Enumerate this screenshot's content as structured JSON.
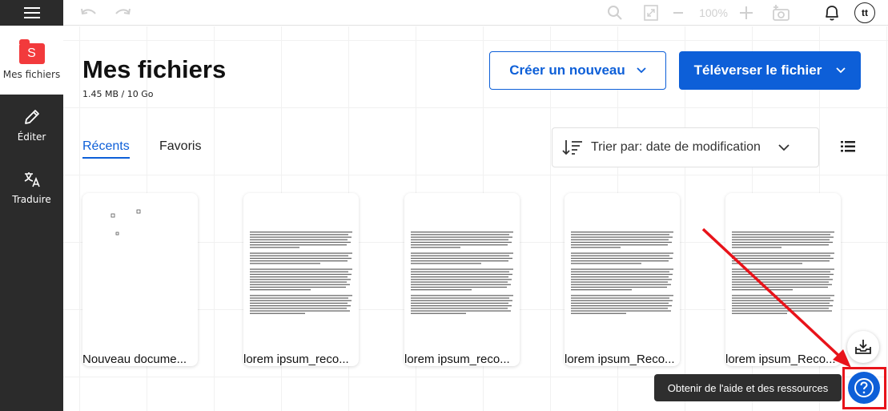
{
  "sidebar": {
    "items": [
      {
        "label": "Mes fichiers",
        "icon": "folder-icon"
      },
      {
        "label": "Éditer",
        "icon": "pencil-icon"
      },
      {
        "label": "Traduire",
        "icon": "translate-icon"
      }
    ],
    "logo_letter": "S"
  },
  "toolbar": {
    "zoom": "100%",
    "avatar_initials": "tt"
  },
  "main": {
    "title": "Mes fichiers",
    "storage": "1.45 MB / 10 Go",
    "create_button": "Créer un nouveau",
    "upload_button": "Téléverser le fichier",
    "tabs": [
      {
        "label": "Récents"
      },
      {
        "label": "Favoris"
      }
    ],
    "sort_label": "Trier par: date de modification",
    "files": [
      {
        "name": "Nouveau docume..."
      },
      {
        "name": "lorem ipsum_reco..."
      },
      {
        "name": "lorem ipsum_reco..."
      },
      {
        "name": "lorem ipsum_Reco..."
      },
      {
        "name": "lorem ipsum_Reco..."
      }
    ]
  },
  "help": {
    "tooltip": "Obtenir de l'aide et des ressources"
  },
  "colors": {
    "accent": "#0d5fd8",
    "brand": "#f23a3c",
    "sidebar": "#2b2b2b",
    "highlight": "#e8131a"
  }
}
